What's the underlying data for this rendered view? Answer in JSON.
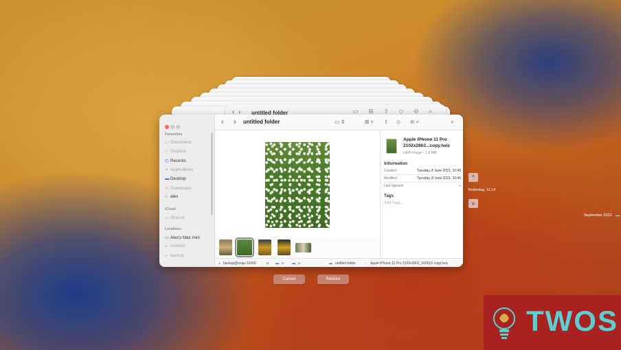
{
  "finder": {
    "title": "untitled folder",
    "back_glyph": "‹",
    "forward_glyph": "›",
    "back_window_title": "untitled folder"
  },
  "sidebar": {
    "favourites_label": "Favourites",
    "favourites": [
      {
        "label": "Documents",
        "icon": "folder-icon",
        "glyph": "▭",
        "dim": true
      },
      {
        "label": "Dropbox",
        "icon": "dropbox-icon",
        "glyph": "◇",
        "dim": true
      },
      {
        "label": "Recents",
        "icon": "clock-icon",
        "glyph": "◴",
        "dim": false
      },
      {
        "label": "Applications",
        "icon": "applications-icon",
        "glyph": "✦",
        "dim": true
      },
      {
        "label": "Desktop",
        "icon": "desktop-icon",
        "glyph": "▬",
        "dim": false
      },
      {
        "label": "Downloads",
        "icon": "download-icon",
        "glyph": "⊙",
        "dim": true
      },
      {
        "label": "alex",
        "icon": "home-icon",
        "glyph": "⌂",
        "dim": false
      }
    ],
    "icloud_label": "iCloud",
    "icloud": [
      {
        "label": "Shared",
        "icon": "shared-folder-icon",
        "glyph": "▭",
        "dim": true
      }
    ],
    "locations_label": "Locations",
    "locations": [
      {
        "label": "Alex's Mac mini",
        "icon": "computer-icon",
        "glyph": "▭",
        "dim": false
      },
      {
        "label": "Untitled",
        "icon": "disk-icon",
        "glyph": "◒",
        "dim": true
      },
      {
        "label": "backup",
        "icon": "disk-icon",
        "glyph": "◒",
        "dim": true
      }
    ]
  },
  "info_panel": {
    "filename": "Apple iPhone 11 Pro 2102x2802...copy.heic",
    "filetype": "HEIF image - 1,8 MB",
    "information_label": "Information",
    "rows": [
      {
        "label": "Created",
        "value": "Tuesday, 8 June 2021, 10:46"
      },
      {
        "label": "Modified",
        "value": "Tuesday, 8 June 2021, 10:46"
      },
      {
        "label": "Last opened",
        "value": "--"
      }
    ],
    "tags_label": "Tags",
    "tags_placeholder": "Add Tags..."
  },
  "path_bar": {
    "items": [
      "backup@snap-19350",
      "u",
      "u",
      "u",
      "untitled folder",
      "Apple iPhone 11 Pro 2102x2802_000010 copy.heic"
    ]
  },
  "buttons": {
    "cancel": "Cancel",
    "restore": "Restore"
  },
  "timeline": {
    "up_arrow": "^",
    "down_arrow": "v",
    "current_label": "Yesterday, 11:14",
    "date_label": "September 2022"
  },
  "watermark": {
    "text": "TWOS"
  },
  "colors": {
    "accent": "#3a7bd5",
    "button": "#c7826c",
    "watermark_bg": "#a82222",
    "watermark_text": "#5ecfd0"
  }
}
